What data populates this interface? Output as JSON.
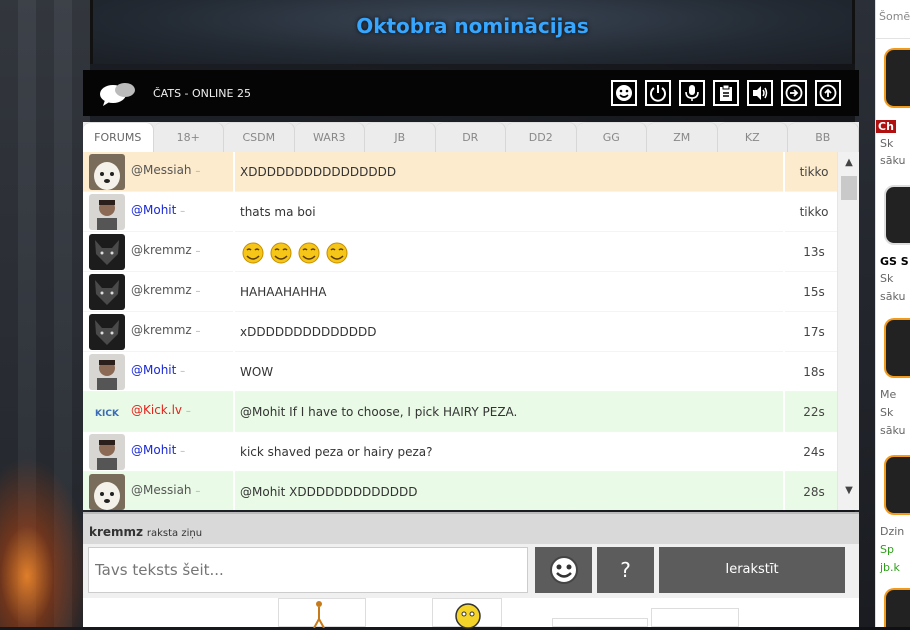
{
  "banner": {
    "title": "Oktobra nominācijas"
  },
  "chat_header": {
    "title": "ČATS - ONLINE 25",
    "icons": [
      "smiley-icon",
      "power-icon",
      "microphone-icon",
      "clipboard-icon",
      "volume-icon",
      "scroll-right-icon",
      "scroll-up-icon"
    ]
  },
  "tabs": [
    "FORUMS",
    "18+",
    "CSDM",
    "WAR3",
    "JB",
    "DR",
    "DD2",
    "GG",
    "ZM",
    "KZ",
    "BB"
  ],
  "messages": [
    {
      "user": "@Messiah",
      "user_color": "default",
      "text": "XDDDDDDDDDDDDDDDD",
      "time": "tikko",
      "highlight": "orange",
      "avatar": "dog"
    },
    {
      "user": "@Mohit",
      "user_color": "blue",
      "text": "thats ma boi",
      "time": "tikko",
      "highlight": "none",
      "avatar": "man"
    },
    {
      "user": "@kremmz",
      "user_color": "default",
      "text": "",
      "time": "13s",
      "highlight": "none",
      "avatar": "wolf",
      "emoji_count": 4
    },
    {
      "user": "@kremmz",
      "user_color": "default",
      "text": "HAHAAHAHHA",
      "time": "15s",
      "highlight": "none",
      "avatar": "wolf"
    },
    {
      "user": "@kremmz",
      "user_color": "default",
      "text": "xDDDDDDDDDDDDDD",
      "time": "17s",
      "highlight": "none",
      "avatar": "wolf"
    },
    {
      "user": "@Mohit",
      "user_color": "blue",
      "text": "WOW",
      "time": "18s",
      "highlight": "none",
      "avatar": "man"
    },
    {
      "user": "@Kick.lv",
      "user_color": "red",
      "text": "@Mohit If I have to choose, I pick HAIRY PEZA.",
      "time": "22s",
      "highlight": "green",
      "avatar": "kick"
    },
    {
      "user": "@Mohit",
      "user_color": "blue",
      "text": "kick shaved peza or hairy peza?",
      "time": "24s",
      "highlight": "none",
      "avatar": "man"
    },
    {
      "user": "@Messiah",
      "user_color": "default",
      "text": "@Mohit XDDDDDDDDDDDDD",
      "time": "28s",
      "highlight": "green",
      "avatar": "dog"
    }
  ],
  "typing": {
    "name": "kremmz",
    "suffix": "raksta ziņu"
  },
  "input": {
    "placeholder": "Tavs teksts šeit...",
    "help_label": "?",
    "send_label": "Ierakstīt"
  },
  "sidebar": {
    "top_label": "Šomē",
    "items": [
      {
        "tag": "Ch",
        "line1": "Sk",
        "line2": "sāku"
      },
      {
        "tag": "GS S",
        "line1": "Sk",
        "line2": "sāku"
      },
      {
        "tag": "Me",
        "line1": "Sk",
        "line2": "sāku"
      },
      {
        "tag": "Dzin",
        "line1": "Sp",
        "line2": "jb.k"
      }
    ]
  },
  "colors": {
    "accent_blue": "#37a6ff",
    "highlight_orange": "#fdebcd",
    "highlight_green": "#e9fbe6",
    "button_gray": "#5c5c5c",
    "user_blue": "#1a29d6",
    "user_red": "#e4231c"
  }
}
